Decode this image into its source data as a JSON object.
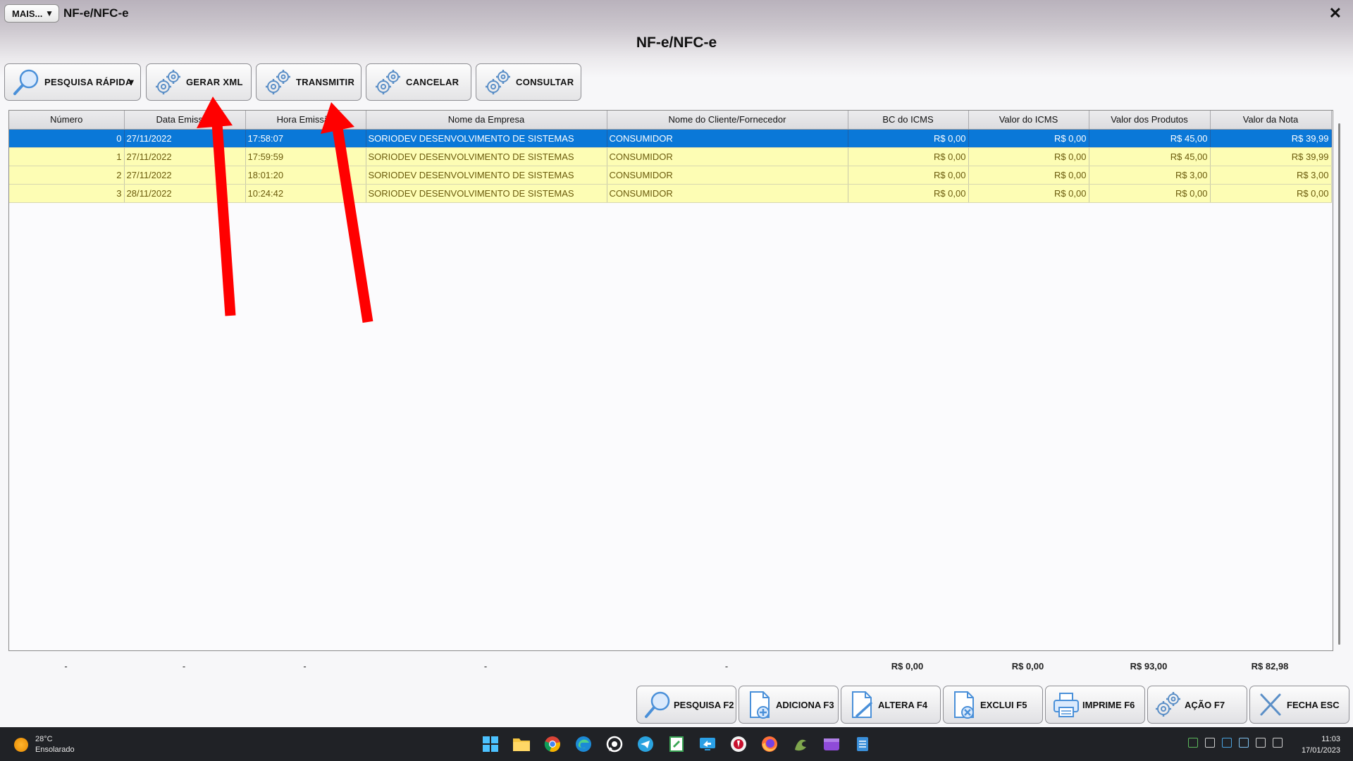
{
  "window": {
    "menu_button": "MAIS...",
    "title": "NF-e/NFC-e",
    "heading": "NF-e/NFC-e",
    "close_glyph": "✕"
  },
  "toolbar": [
    {
      "label": "PESQUISA RÁPIDA",
      "icon": "magnifier-icon",
      "dropdown": "▼"
    },
    {
      "label": "GERAR XML",
      "icon": "gears-icon"
    },
    {
      "label": "TRANSMITIR",
      "icon": "gears-icon"
    },
    {
      "label": "CANCELAR",
      "icon": "gears-icon"
    },
    {
      "label": "CONSULTAR",
      "icon": "gears-icon"
    }
  ],
  "grid": {
    "columns": [
      "Número",
      "Data Emissão",
      "Hora Emissão",
      "Nome da Empresa",
      "Nome do Cliente/Fornecedor",
      "BC do ICMS",
      "Valor do ICMS",
      "Valor dos Produtos",
      "Valor da Nota"
    ],
    "rows": [
      {
        "numero": "0",
        "data": "27/11/2022",
        "hora": "17:58:07",
        "empresa": "SORIODEV DESENVOLVIMENTO DE SISTEMAS",
        "cliente": "CONSUMIDOR",
        "bc_icms": "R$ 0,00",
        "valor_icms": "R$ 0,00",
        "valor_produtos": "R$ 45,00",
        "valor_nota": "R$ 39,99",
        "selected": true
      },
      {
        "numero": "1",
        "data": "27/11/2022",
        "hora": "17:59:59",
        "empresa": "SORIODEV DESENVOLVIMENTO DE SISTEMAS",
        "cliente": "CONSUMIDOR",
        "bc_icms": "R$ 0,00",
        "valor_icms": "R$ 0,00",
        "valor_produtos": "R$ 45,00",
        "valor_nota": "R$ 39,99",
        "selected": false
      },
      {
        "numero": "2",
        "data": "27/11/2022",
        "hora": "18:01:20",
        "empresa": "SORIODEV DESENVOLVIMENTO DE SISTEMAS",
        "cliente": "CONSUMIDOR",
        "bc_icms": "R$ 0,00",
        "valor_icms": "R$ 0,00",
        "valor_produtos": "R$ 3,00",
        "valor_nota": "R$ 3,00",
        "selected": false
      },
      {
        "numero": "3",
        "data": "28/11/2022",
        "hora": "10:24:42",
        "empresa": "SORIODEV DESENVOLVIMENTO DE SISTEMAS",
        "cliente": "CONSUMIDOR",
        "bc_icms": "R$ 0,00",
        "valor_icms": "R$ 0,00",
        "valor_produtos": "R$ 0,00",
        "valor_nota": "R$ 0,00",
        "selected": false
      }
    ],
    "selected_row_color": "#0a78d8",
    "row_color": "#fdfdb4"
  },
  "totals": [
    "-",
    "-",
    "-",
    "-",
    "-",
    "R$ 0,00",
    "R$ 0,00",
    "R$ 93,00",
    "R$ 82,98"
  ],
  "actions": [
    {
      "label": "PESQUISA F2",
      "icon": "magnifier-icon"
    },
    {
      "label": "ADICIONA F3",
      "icon": "document-add-icon"
    },
    {
      "label": "ALTERA F4",
      "icon": "document-edit-icon"
    },
    {
      "label": "EXCLUI F5",
      "icon": "document-delete-icon"
    },
    {
      "label": "IMPRIME F6",
      "icon": "printer-icon"
    },
    {
      "label": "AÇÃO F7",
      "icon": "gears-icon"
    },
    {
      "label": "FECHA ESC",
      "icon": "close-icon"
    }
  ],
  "annotation_color": "#ff0000",
  "taskbar": {
    "temperature": "28°C",
    "weather": "Ensolarado",
    "apps": [
      "start-icon",
      "file-explorer-icon",
      "chrome-icon",
      "edge-icon",
      "whatsapp-icon",
      "telegram-icon",
      "notepad-green-icon",
      "remote-desktop-icon",
      "app-red-icon",
      "firefox-icon",
      "app-green-icon",
      "media-player-icon",
      "notepad-icon"
    ],
    "time": "11:03",
    "date": "17/01/2023"
  }
}
